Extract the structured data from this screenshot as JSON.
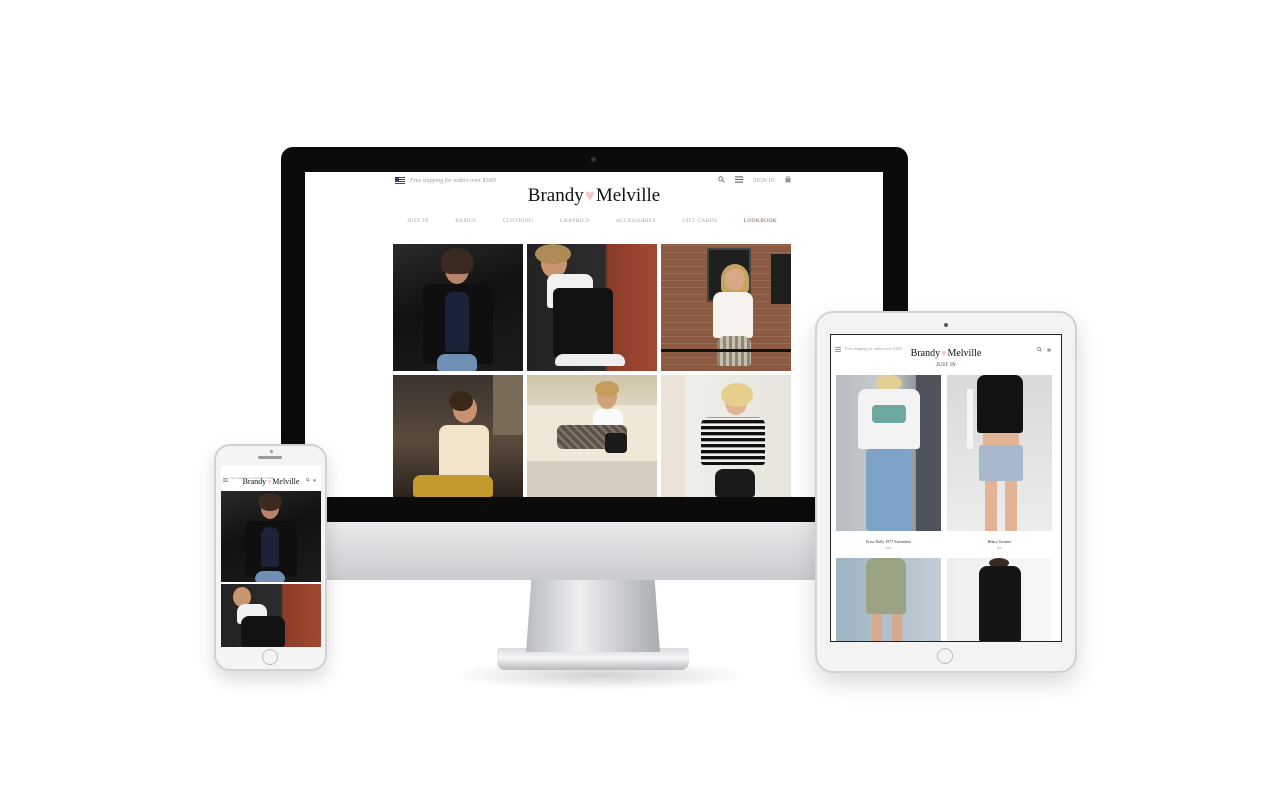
{
  "desktop": {
    "shipping_text": "Free shipping for orders over $100!",
    "brand_left": "Brandy",
    "brand_right": "Melville",
    "heart": "♥",
    "sign_in": "SIGN IN",
    "icons": [
      "search-icon",
      "menu-icon",
      "bag-icon"
    ],
    "nav": [
      {
        "label": "JUST IN"
      },
      {
        "label": "BASICS"
      },
      {
        "label": "CLOTHING"
      },
      {
        "label": "GRAPHICS"
      },
      {
        "label": "ACCESSORIES"
      },
      {
        "label": "GIFT CARDS"
      },
      {
        "label": "LOOKBOOK",
        "active": true
      }
    ]
  },
  "tablet": {
    "shipping_text": "Free shipping for orders over $100!",
    "brand_left": "Brandy",
    "brand_right": "Melville",
    "section_title": "JUST IN",
    "products": [
      {
        "name": "Erica Daily 1977 Sweatshirt",
        "price": "$36"
      },
      {
        "name": "Hilary Sweater",
        "price": "$32"
      }
    ]
  },
  "phone": {
    "shipping_text": "Free shipping for orders over $100!",
    "brand_left": "Brandy",
    "brand_right": "Melville"
  },
  "colors": {
    "heart": "#f6c6cc",
    "nav_text": "#a3a3a3",
    "nav_active": "#7a5a4e",
    "frame": "#0b0b0b"
  }
}
